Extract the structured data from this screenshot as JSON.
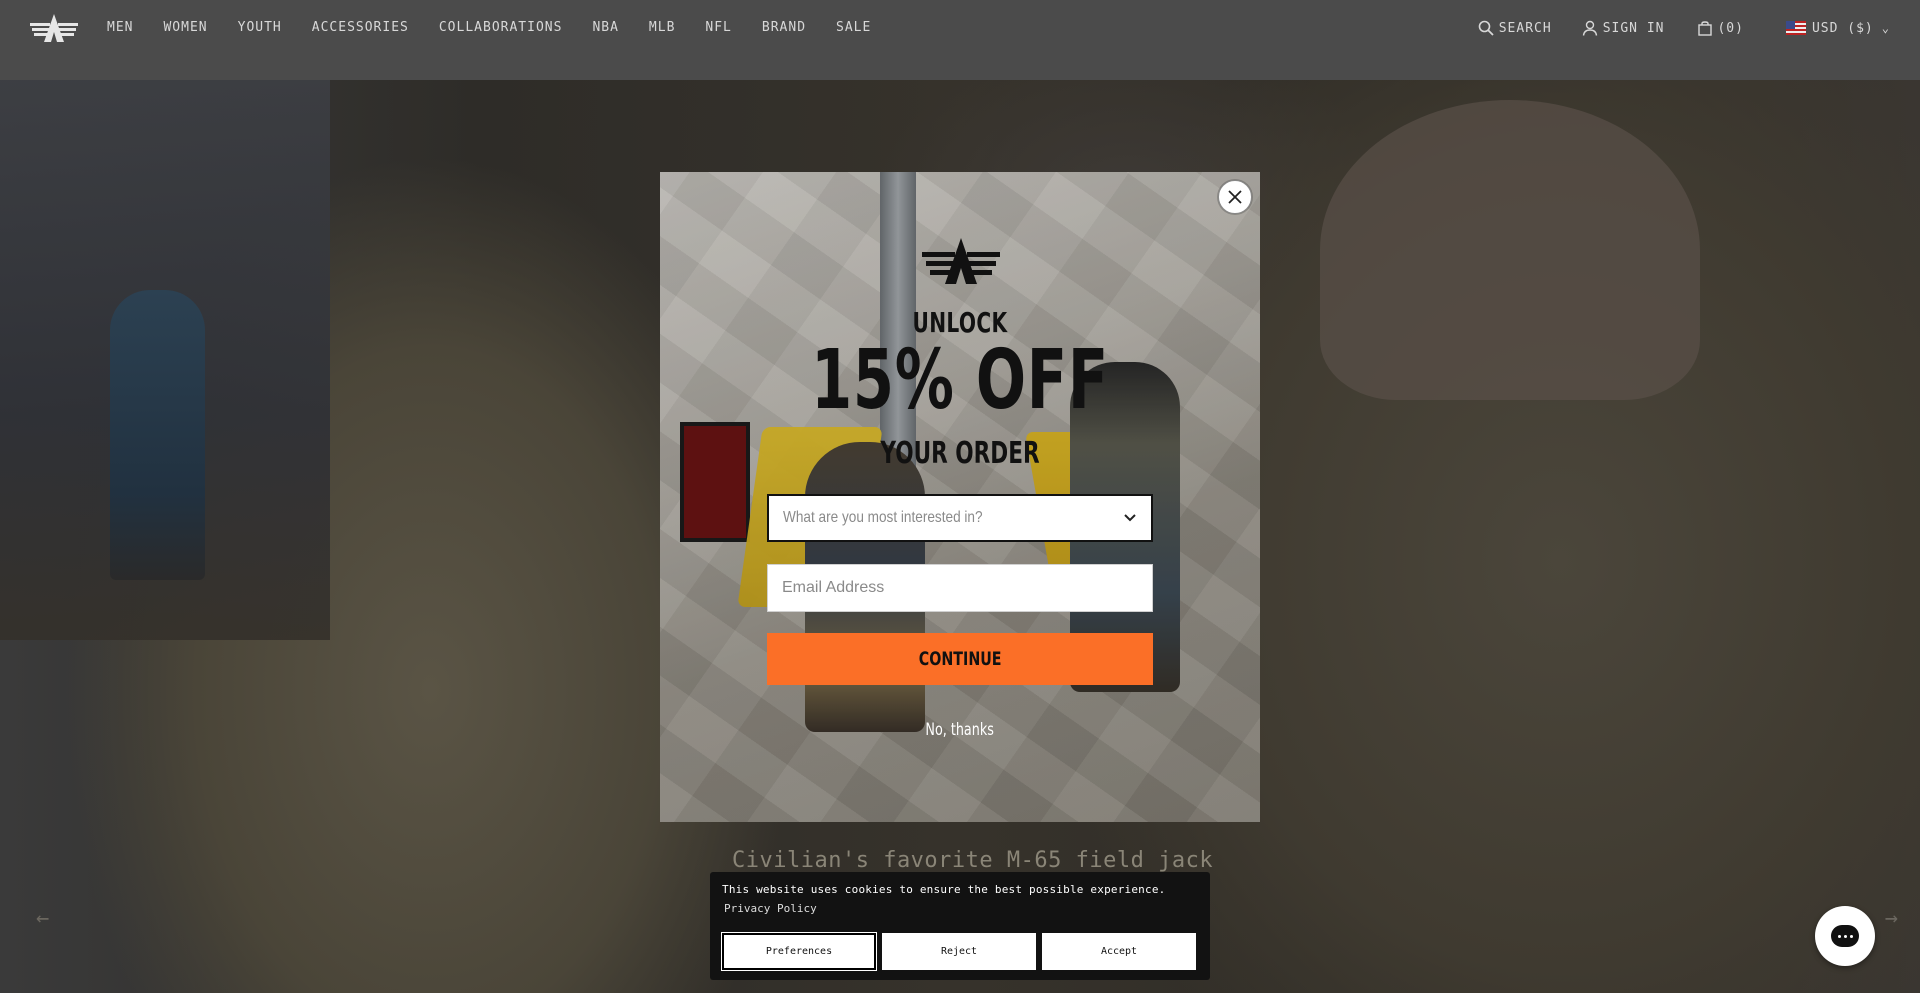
{
  "header": {
    "nav": [
      "MEN",
      "WOMEN",
      "YOUTH",
      "ACCESSORIES",
      "COLLABORATIONS",
      "NBA",
      "MLB",
      "NFL",
      "BRAND",
      "SALE"
    ],
    "search_label": "SEARCH",
    "sign_in_label": "SIGN IN",
    "cart_label": "(0)",
    "currency_label": "USD ($)",
    "icons": {
      "search": "search-icon",
      "user": "user-icon",
      "cart": "bag-icon",
      "flag": "us-flag-icon",
      "caret": "chevron-down-icon"
    }
  },
  "hero": {
    "caption": "Civilian's favorite M-65 field jack",
    "arrow_left": "←",
    "arrow_right": "→"
  },
  "modal": {
    "unlock": "UNLOCK",
    "percent": "15% OFF",
    "your_order": "YOUR ORDER",
    "interest_placeholder": "What are you most interested in?",
    "email_placeholder": "Email Address",
    "continue_label": "CONTINUE",
    "no_thanks": "No, thanks",
    "accent_color": "#fb6f27"
  },
  "cookie": {
    "message": "This website uses cookies to ensure the best possible experience.",
    "privacy_link": "Privacy Policy",
    "preferences": "Preferences",
    "reject": "Reject",
    "accept": "Accept"
  },
  "chat": {
    "icon": "chat-icon"
  }
}
